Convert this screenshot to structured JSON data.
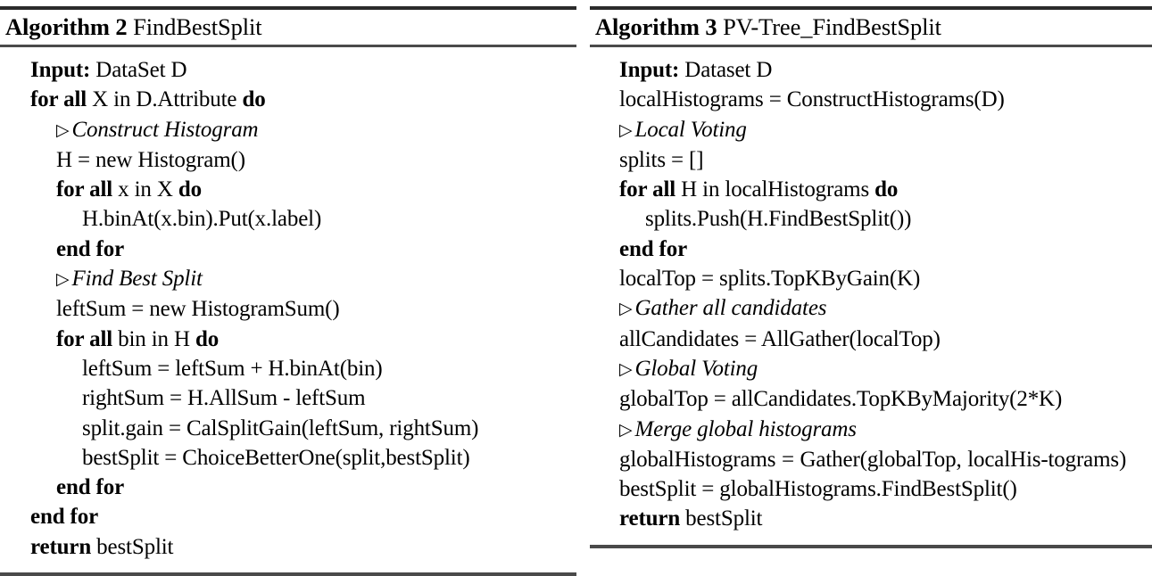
{
  "document": {
    "type": "algorithm-figure",
    "columns": 2
  },
  "algorithms": [
    {
      "label": "Algorithm 2",
      "name": "FindBestSplit",
      "lines": [
        {
          "indent": 0,
          "kw": "Input:",
          "rest": " DataSet D"
        },
        {
          "indent": 0,
          "kw": "for all",
          "rest": " X in D.Attribute ",
          "kw2": "do"
        },
        {
          "indent": 1,
          "comment": "Construct Histogram"
        },
        {
          "indent": 1,
          "text": "H = new Histogram()"
        },
        {
          "indent": 1,
          "kw": "for all",
          "rest": " x in X ",
          "kw2": "do"
        },
        {
          "indent": 2,
          "text": "H.binAt(x.bin).Put(x.label)"
        },
        {
          "indent": 1,
          "kw": "end for"
        },
        {
          "indent": 1,
          "comment": "Find Best Split"
        },
        {
          "indent": 1,
          "text": "leftSum = new HistogramSum()"
        },
        {
          "indent": 1,
          "kw": "for all",
          "rest": " bin in H ",
          "kw2": "do"
        },
        {
          "indent": 2,
          "text": "leftSum = leftSum + H.binAt(bin)"
        },
        {
          "indent": 2,
          "text": "rightSum = H.AllSum - leftSum"
        },
        {
          "indent": 2,
          "text": "split.gain = CalSplitGain(leftSum, rightSum)"
        },
        {
          "indent": 2,
          "text": "bestSplit = ChoiceBetterOne(split,bestSplit)"
        },
        {
          "indent": 1,
          "kw": "end for"
        },
        {
          "indent": 0,
          "kw": "end for"
        },
        {
          "indent": 0,
          "kw": "return",
          "rest": " bestSplit"
        }
      ]
    },
    {
      "label": "Algorithm 3",
      "name": "PV-Tree_FindBestSplit",
      "lines": [
        {
          "indent": 0,
          "kw": "Input:",
          "rest": " Dataset D"
        },
        {
          "indent": 0,
          "text": "localHistograms = ConstructHistograms(D)"
        },
        {
          "indent": 0,
          "comment": "Local Voting"
        },
        {
          "indent": 0,
          "text": "splits = []"
        },
        {
          "indent": 0,
          "kw": "for all",
          "rest": " H in localHistograms ",
          "kw2": "do"
        },
        {
          "indent": 1,
          "text": "splits.Push(H.FindBestSplit())"
        },
        {
          "indent": 0,
          "kw": "end for"
        },
        {
          "indent": 0,
          "text": "localTop = splits.TopKByGain(K)"
        },
        {
          "indent": 0,
          "comment": "Gather all candidates"
        },
        {
          "indent": 0,
          "text": "allCandidates = AllGather(localTop)"
        },
        {
          "indent": 0,
          "comment": "Global Voting"
        },
        {
          "indent": 0,
          "text": "globalTop = allCandidates.TopKByMajority(2*K)"
        },
        {
          "indent": 0,
          "comment": "Merge global histograms"
        },
        {
          "indent": 0,
          "wrapped": true,
          "text": "globalHistograms = Gather(globalTop, localHistograms)",
          "part1": "globalHistograms",
          "part2": "=",
          "part3": "Gather(globalTop,",
          "part4": "localHis-",
          "part5": "tograms)"
        },
        {
          "indent": 0,
          "text": "bestSplit = globalHistograms.FindBestSplit()"
        },
        {
          "indent": 0,
          "kw": "return",
          "rest": " bestSplit"
        }
      ]
    }
  ],
  "glyphs": {
    "comment_marker": "▷"
  }
}
